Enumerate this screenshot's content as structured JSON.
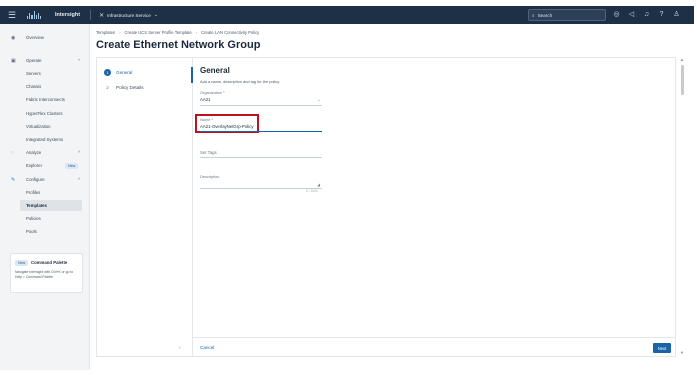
{
  "topbar": {
    "app_name": "Intersight",
    "service": "Infrastructure Service",
    "search_placeholder": "Search"
  },
  "sidebar": {
    "items": [
      {
        "label": "Overview"
      },
      {
        "label": "Operate"
      },
      {
        "label": "Servers"
      },
      {
        "label": "Chassis"
      },
      {
        "label": "Fabric Interconnects"
      },
      {
        "label": "HyperFlex Clusters"
      },
      {
        "label": "Virtualization"
      },
      {
        "label": "Integrated Systems"
      },
      {
        "label": "Analyze"
      },
      {
        "label": "Explorer"
      },
      {
        "label": "Configure"
      },
      {
        "label": "Profiles"
      },
      {
        "label": "Templates"
      },
      {
        "label": "Policies"
      },
      {
        "label": "Pools"
      }
    ],
    "explorer_badge": "New",
    "command_palette": {
      "badge": "New",
      "title": "Command Palette",
      "text": "Navigate Intersight with Ctrl+K or go to Help > Command Palette"
    }
  },
  "breadcrumb": [
    "Templates",
    "Create UCS Server Profile Template",
    "Create LAN Connectivity Policy"
  ],
  "page_title": "Create Ethernet Network Group",
  "wizard": {
    "steps": [
      {
        "num": "1",
        "label": "General"
      },
      {
        "num": "2",
        "label": "Policy Details"
      }
    ]
  },
  "general": {
    "title": "General",
    "subtitle": "Add a name, description and tag for the policy.",
    "organization_label": "Organization *",
    "organization_value": "AA21",
    "name_label": "Name *",
    "name_value": "AA21-OverlayNetGrp-Policy",
    "tags_placeholder": "Set Tags",
    "description_label": "Description",
    "counter": "0 / 1024"
  },
  "footer": {
    "cancel_label": "Cancel",
    "next_label": "Next"
  },
  "colors": {
    "topbar": "#1d3045",
    "accent": "#1a63a8",
    "highlight": "#c0101b"
  }
}
